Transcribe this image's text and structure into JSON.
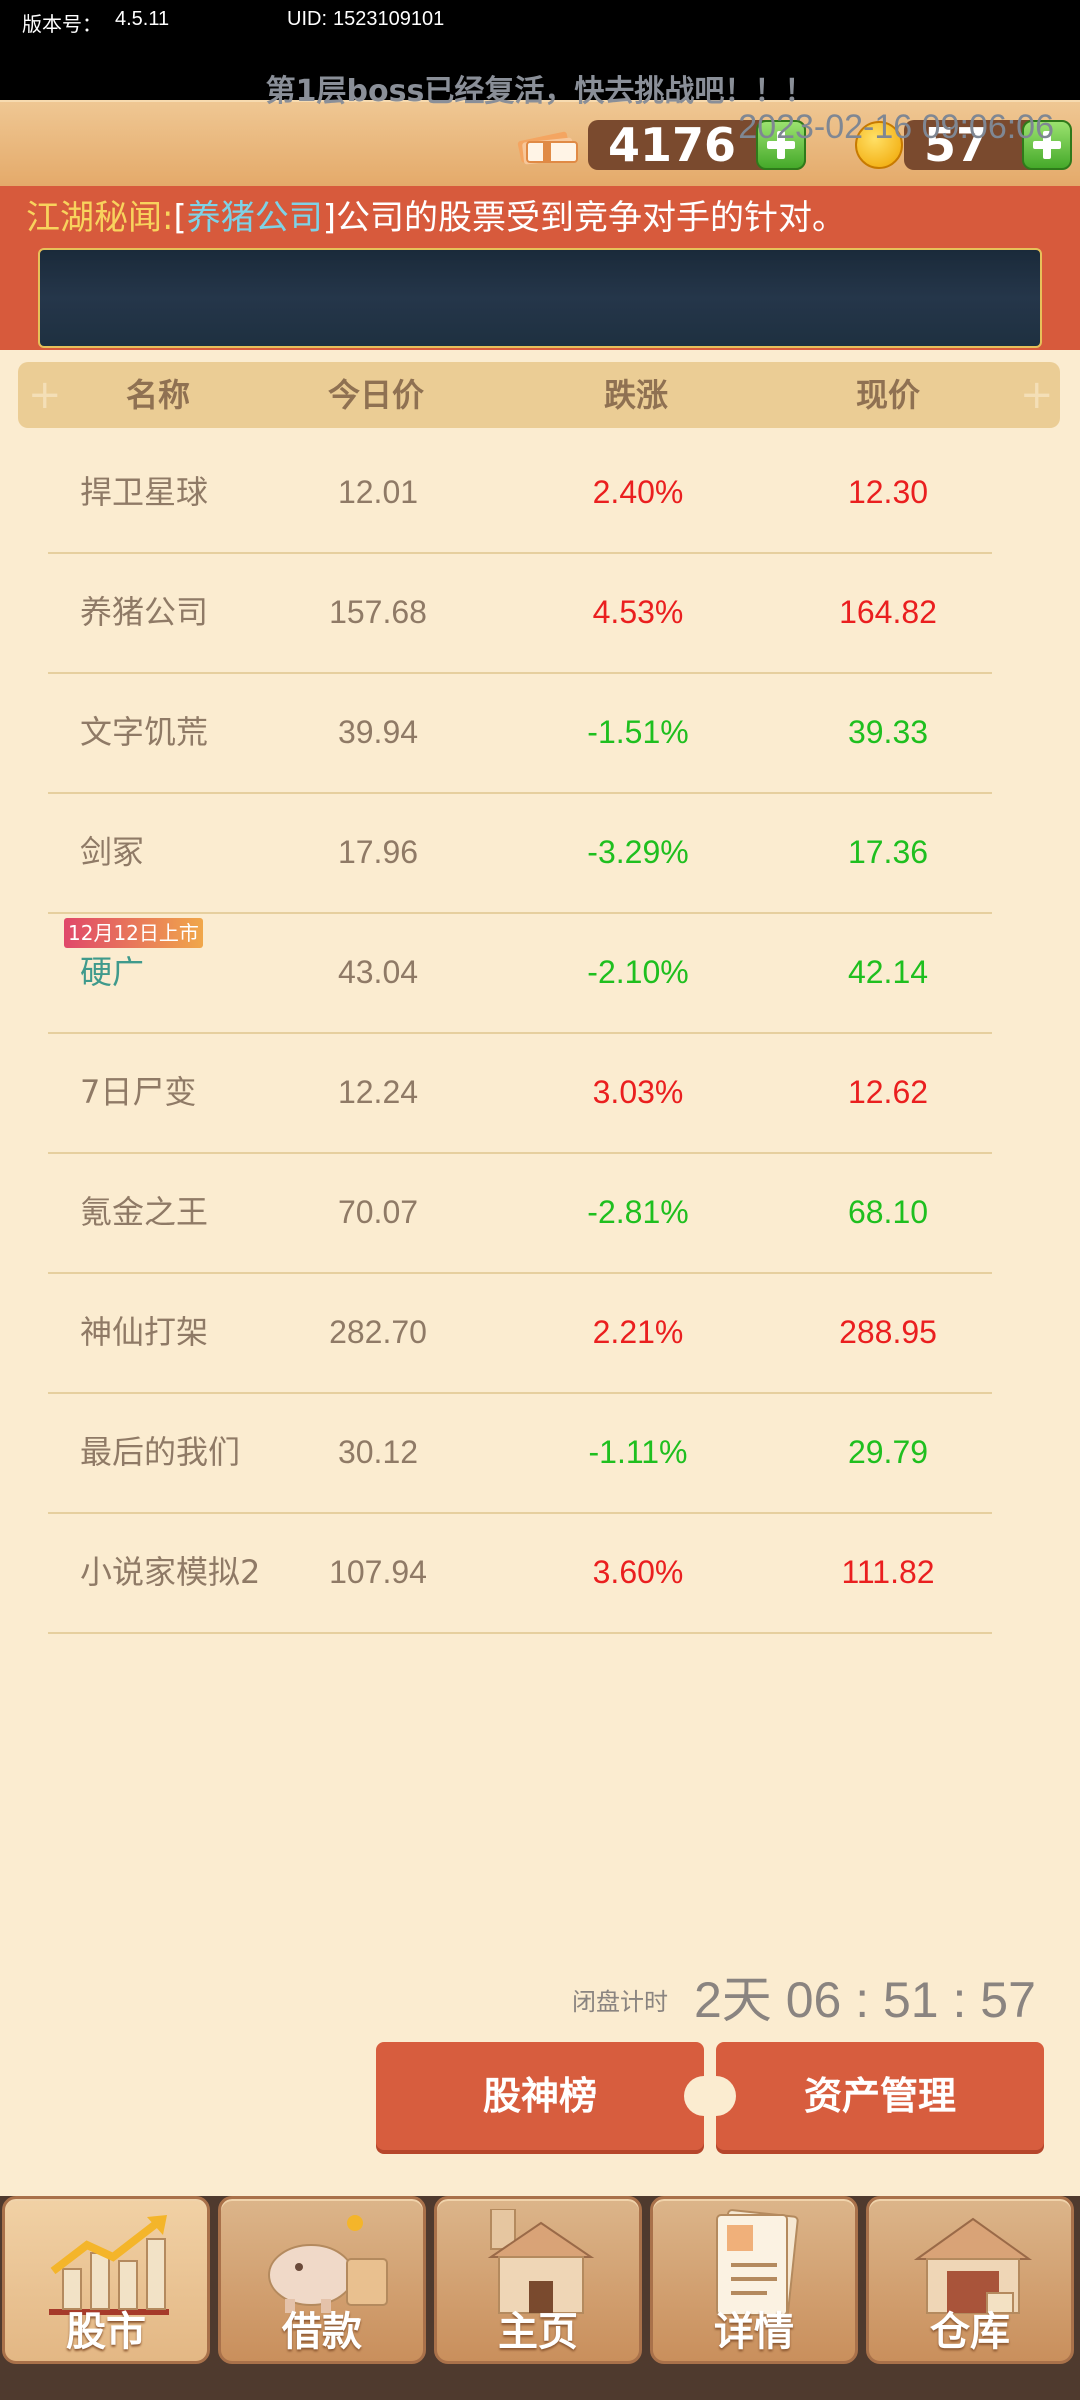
{
  "status_bar": {
    "version_label": "版本号：",
    "version": "4.5.11",
    "uid_label": "UID:",
    "uid": "1523109101"
  },
  "resources": {
    "cash": "4176",
    "gold": "57"
  },
  "news": {
    "label": "江湖秘闻:",
    "open_bracket": "[",
    "company": "养猪公司",
    "close_bracket": "]",
    "text": "公司的股票受到竞争对手的针对。",
    "notice": "第1层boss已经复活，快去挑战吧！！！",
    "date": "2023-02-16 09:06:06"
  },
  "table": {
    "headers": [
      "名称",
      "今日价",
      "跌涨",
      "现价"
    ],
    "rows": [
      {
        "name": "捍卫星球",
        "today": "12.01",
        "change": "2.40%",
        "current": "12.30",
        "trend": "up"
      },
      {
        "name": "养猪公司",
        "today": "157.68",
        "change": "4.53%",
        "current": "164.82",
        "trend": "up"
      },
      {
        "name": "文字饥荒",
        "today": "39.94",
        "change": "-1.51%",
        "current": "39.33",
        "trend": "down"
      },
      {
        "name": "剑冢",
        "today": "17.96",
        "change": "-3.29%",
        "current": "17.36",
        "trend": "down"
      },
      {
        "name": "硬广",
        "today": "43.04",
        "change": "-2.10%",
        "current": "42.14",
        "trend": "down",
        "badge": "12月12日上市"
      },
      {
        "name": "7日尸变",
        "today": "12.24",
        "change": "3.03%",
        "current": "12.62",
        "trend": "up"
      },
      {
        "name": "氪金之王",
        "today": "70.07",
        "change": "-2.81%",
        "current": "68.10",
        "trend": "down"
      },
      {
        "name": "神仙打架",
        "today": "282.70",
        "change": "2.21%",
        "current": "288.95",
        "trend": "up"
      },
      {
        "name": "最后的我们",
        "today": "30.12",
        "change": "-1.11%",
        "current": "29.79",
        "trend": "down"
      },
      {
        "name": "小说家模拟2",
        "today": "107.94",
        "change": "3.60%",
        "current": "111.82",
        "trend": "up"
      }
    ]
  },
  "timer": {
    "label": "闭盘计时",
    "value": "2天 06 : 51 : 57"
  },
  "actions": {
    "leaderboard": "股神榜",
    "asset_management": "资产管理"
  },
  "tabs": [
    {
      "label": "股市",
      "icon": "stock-chart-icon"
    },
    {
      "label": "借款",
      "icon": "piggy-bank-icon"
    },
    {
      "label": "主页",
      "icon": "home-icon"
    },
    {
      "label": "详情",
      "icon": "document-icon"
    },
    {
      "label": "仓库",
      "icon": "warehouse-icon"
    }
  ],
  "colors": {
    "up": "#ea1f1f",
    "down": "#1fbf1f",
    "accent": "#d75d3e",
    "background": "#fbecd0"
  }
}
